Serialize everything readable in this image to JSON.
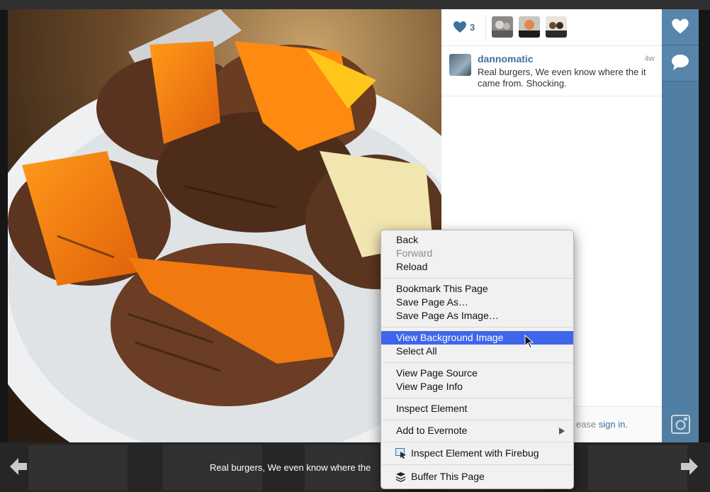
{
  "photo": {
    "alt": ""
  },
  "likes": {
    "count": "3"
  },
  "comment": {
    "username": "dannomatic",
    "time": "4w",
    "text": "Real burgers, We even know where the it came from. Shocking."
  },
  "signin": {
    "prefix": "ease",
    "link": "sign in."
  },
  "caption": "Real burgers, We even know where the",
  "colors": {
    "accent": "#3f729b",
    "bar": "#517fa4",
    "menu_highlight": "#3f66ea"
  },
  "context_menu": {
    "back": "Back",
    "forward": "Forward",
    "reload": "Reload",
    "bookmark": "Bookmark This Page",
    "save_as": "Save Page As…",
    "save_as_image": "Save Page As Image…",
    "view_bg_image": "View Background Image",
    "select_all": "Select All",
    "view_source": "View Page Source",
    "view_info": "View Page Info",
    "inspect": "Inspect Element",
    "evernote": "Add to Evernote",
    "firebug": "Inspect Element with Firebug",
    "buffer": "Buffer This Page"
  }
}
